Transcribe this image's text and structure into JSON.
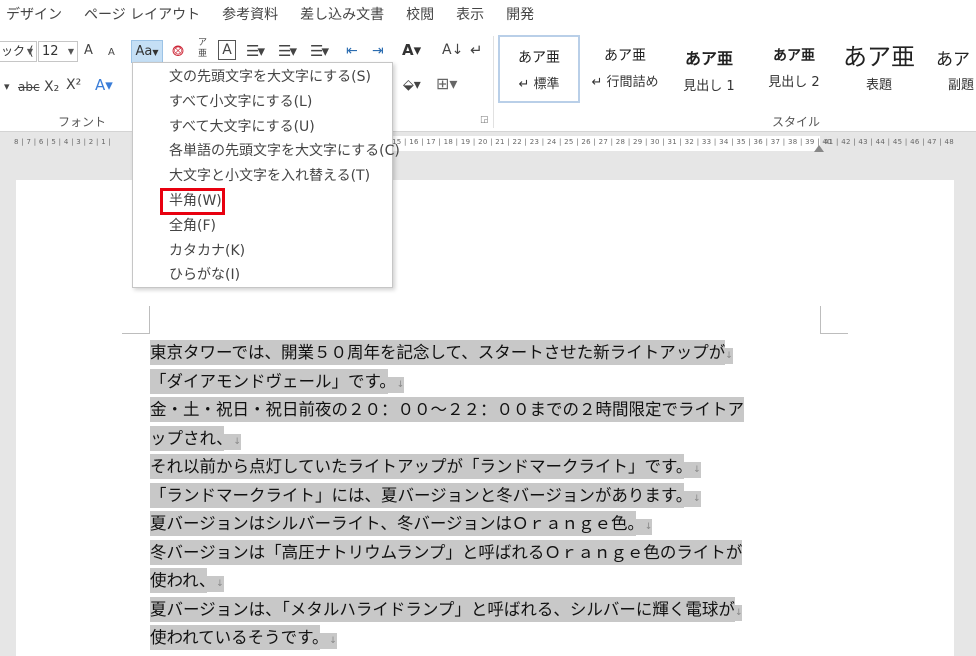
{
  "ribbon_tabs": [
    "デザイン",
    "ページ レイアウト",
    "参考資料",
    "差し込み文書",
    "校閲",
    "表示",
    "開発"
  ],
  "font": {
    "font_name": "ック (",
    "font_size": "12",
    "grow_font_label": "A",
    "shrink_font_label": "A",
    "change_case_label": "Aa",
    "strikethrough_label": "abc",
    "subscript_label": "X₂",
    "superscript_label": "X²",
    "group_label": "フォント"
  },
  "styles": {
    "group_label": "スタイル",
    "items": [
      {
        "preview": "あア亜",
        "name": "↵ 標準"
      },
      {
        "preview": "あア亜",
        "name": "↵ 行間詰め"
      },
      {
        "preview": "あア亜",
        "name": "見出し 1"
      },
      {
        "preview": "あア亜",
        "name": "見出し 2"
      },
      {
        "preview": "あア亜",
        "name": "表題"
      },
      {
        "preview": "あア",
        "name": "副題"
      }
    ]
  },
  "ruler": {
    "left": "8 | 7 | 6 | 5 | 4 | 3 | 2 | 1 |",
    "right": "15 | 16 | 17 | 18 | 19 | 20 | 21 | 22 | 23 | 24 | 25 | 26 | 27 | 28 | 29 | 30 | 31 | 32 | 33 | 34 | 35 | 36 | 37 | 38 | 39 | 40",
    "far_right": "41 | 42 | 43 | 44 | 45 | 46 | 47 | 48"
  },
  "change_case_menu": {
    "items": [
      "文の先頭文字を大文字にする(S)",
      "すべて小文字にする(L)",
      "すべて大文字にする(U)",
      "各単語の先頭文字を大文字にする(C)",
      "大文字と小文字を入れ替える(T)",
      "半角(W)",
      "全角(F)",
      "カタカナ(K)",
      "ひらがな(I)"
    ]
  },
  "document": {
    "lines": [
      "東京タワーでは、開業５０周年を記念して、スタートさせた新ライトアップが",
      "「ダイアモンドヴェール」です。",
      "金・土・祝日・祝日前夜の２０：００～２２：００までの２時間限定でライトア",
      "ップされ、",
      "それ以前から点灯していたライトアップが「ランドマークライト」です。",
      "「ランドマークライト」には、夏バージョンと冬バージョンがあります。",
      "夏バージョンはシルバーライト、冬バージョンはＯｒａｎｇｅ色。",
      "冬バージョンは「高圧ナトリウムランプ」と呼ばれるＯｒａｎｇｅ色のライトが",
      "使われ、",
      "夏バージョンは、「メタルハライドランプ」と呼ばれる、シルバーに輝く電球が",
      "使われているそうです。"
    ]
  },
  "colors": {
    "selection_highlight": "#c8c8c8",
    "active_button": "#c5dff5",
    "red_callout": "#e8000f"
  }
}
